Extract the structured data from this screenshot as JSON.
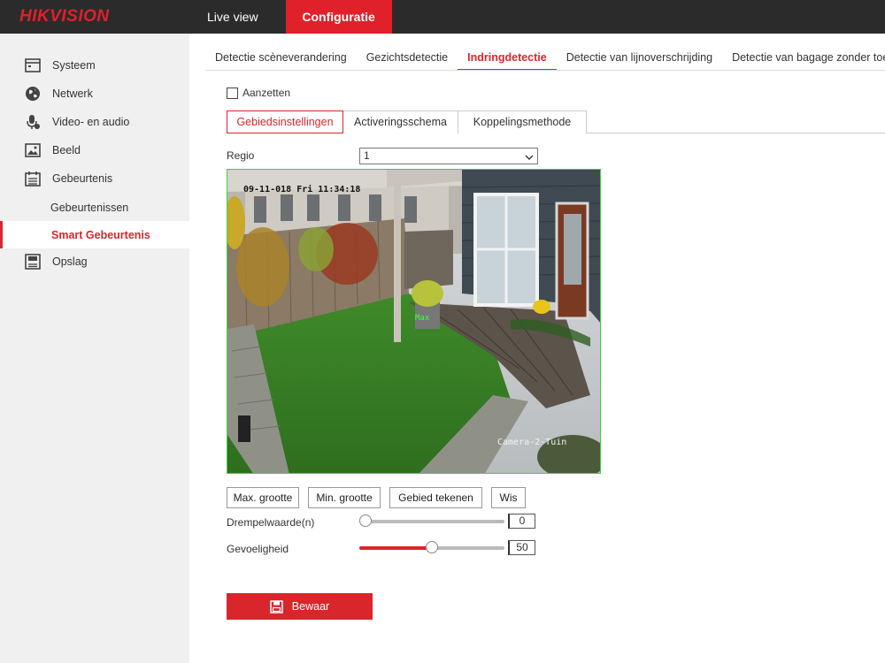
{
  "brand": {
    "logo": "HIKVISION"
  },
  "topnav": {
    "live_view": "Live view",
    "config": "Configuratie"
  },
  "sidebar": {
    "items": [
      {
        "label": "Systeem",
        "icon": "monitor-icon"
      },
      {
        "label": "Netwerk",
        "icon": "globe-icon"
      },
      {
        "label": "Video- en audio",
        "icon": "microphone-icon"
      },
      {
        "label": "Beeld",
        "icon": "image-icon"
      },
      {
        "label": "Gebeurtenis",
        "icon": "calendar-icon"
      },
      {
        "label": "Opslag",
        "icon": "storage-icon"
      }
    ],
    "subitems": [
      {
        "label": "Gebeurtenissen"
      },
      {
        "label": "Smart Gebeurtenis"
      }
    ]
  },
  "subtabs": [
    "Detectie scèneverandering",
    "Gezichtsdetectie",
    "Indringdetectie",
    "Detectie van lijnoverschrijding",
    "Detectie van bagage zonder toezicht"
  ],
  "enable": {
    "label": "Aanzetten",
    "checked": false
  },
  "steps": [
    "Gebiedsinstellingen",
    "Activeringsschema",
    "Koppelingsmethode"
  ],
  "region": {
    "label": "Regio",
    "value": "1"
  },
  "video": {
    "osd_time": "09-11-018 Fri 11:34:18",
    "osd_camera": "Camera-2-Tuin",
    "osd_max": "Max"
  },
  "buttons": {
    "max_size": "Max. grootte",
    "min_size": "Min. grootte",
    "draw_area": "Gebied tekenen",
    "clear": "Wis"
  },
  "threshold": {
    "label": "Drempelwaarde(n)",
    "value": "0",
    "fraction": 0
  },
  "sensitivity": {
    "label": "Gevoeligheid",
    "value": "50",
    "fraction": 0.5
  },
  "save": {
    "label": "Bewaar"
  },
  "colors": {
    "accent": "#d9262c",
    "topbar": "#2b2b2b",
    "sidebar": "#f0f0f0",
    "region_border": "#3fd13f"
  }
}
